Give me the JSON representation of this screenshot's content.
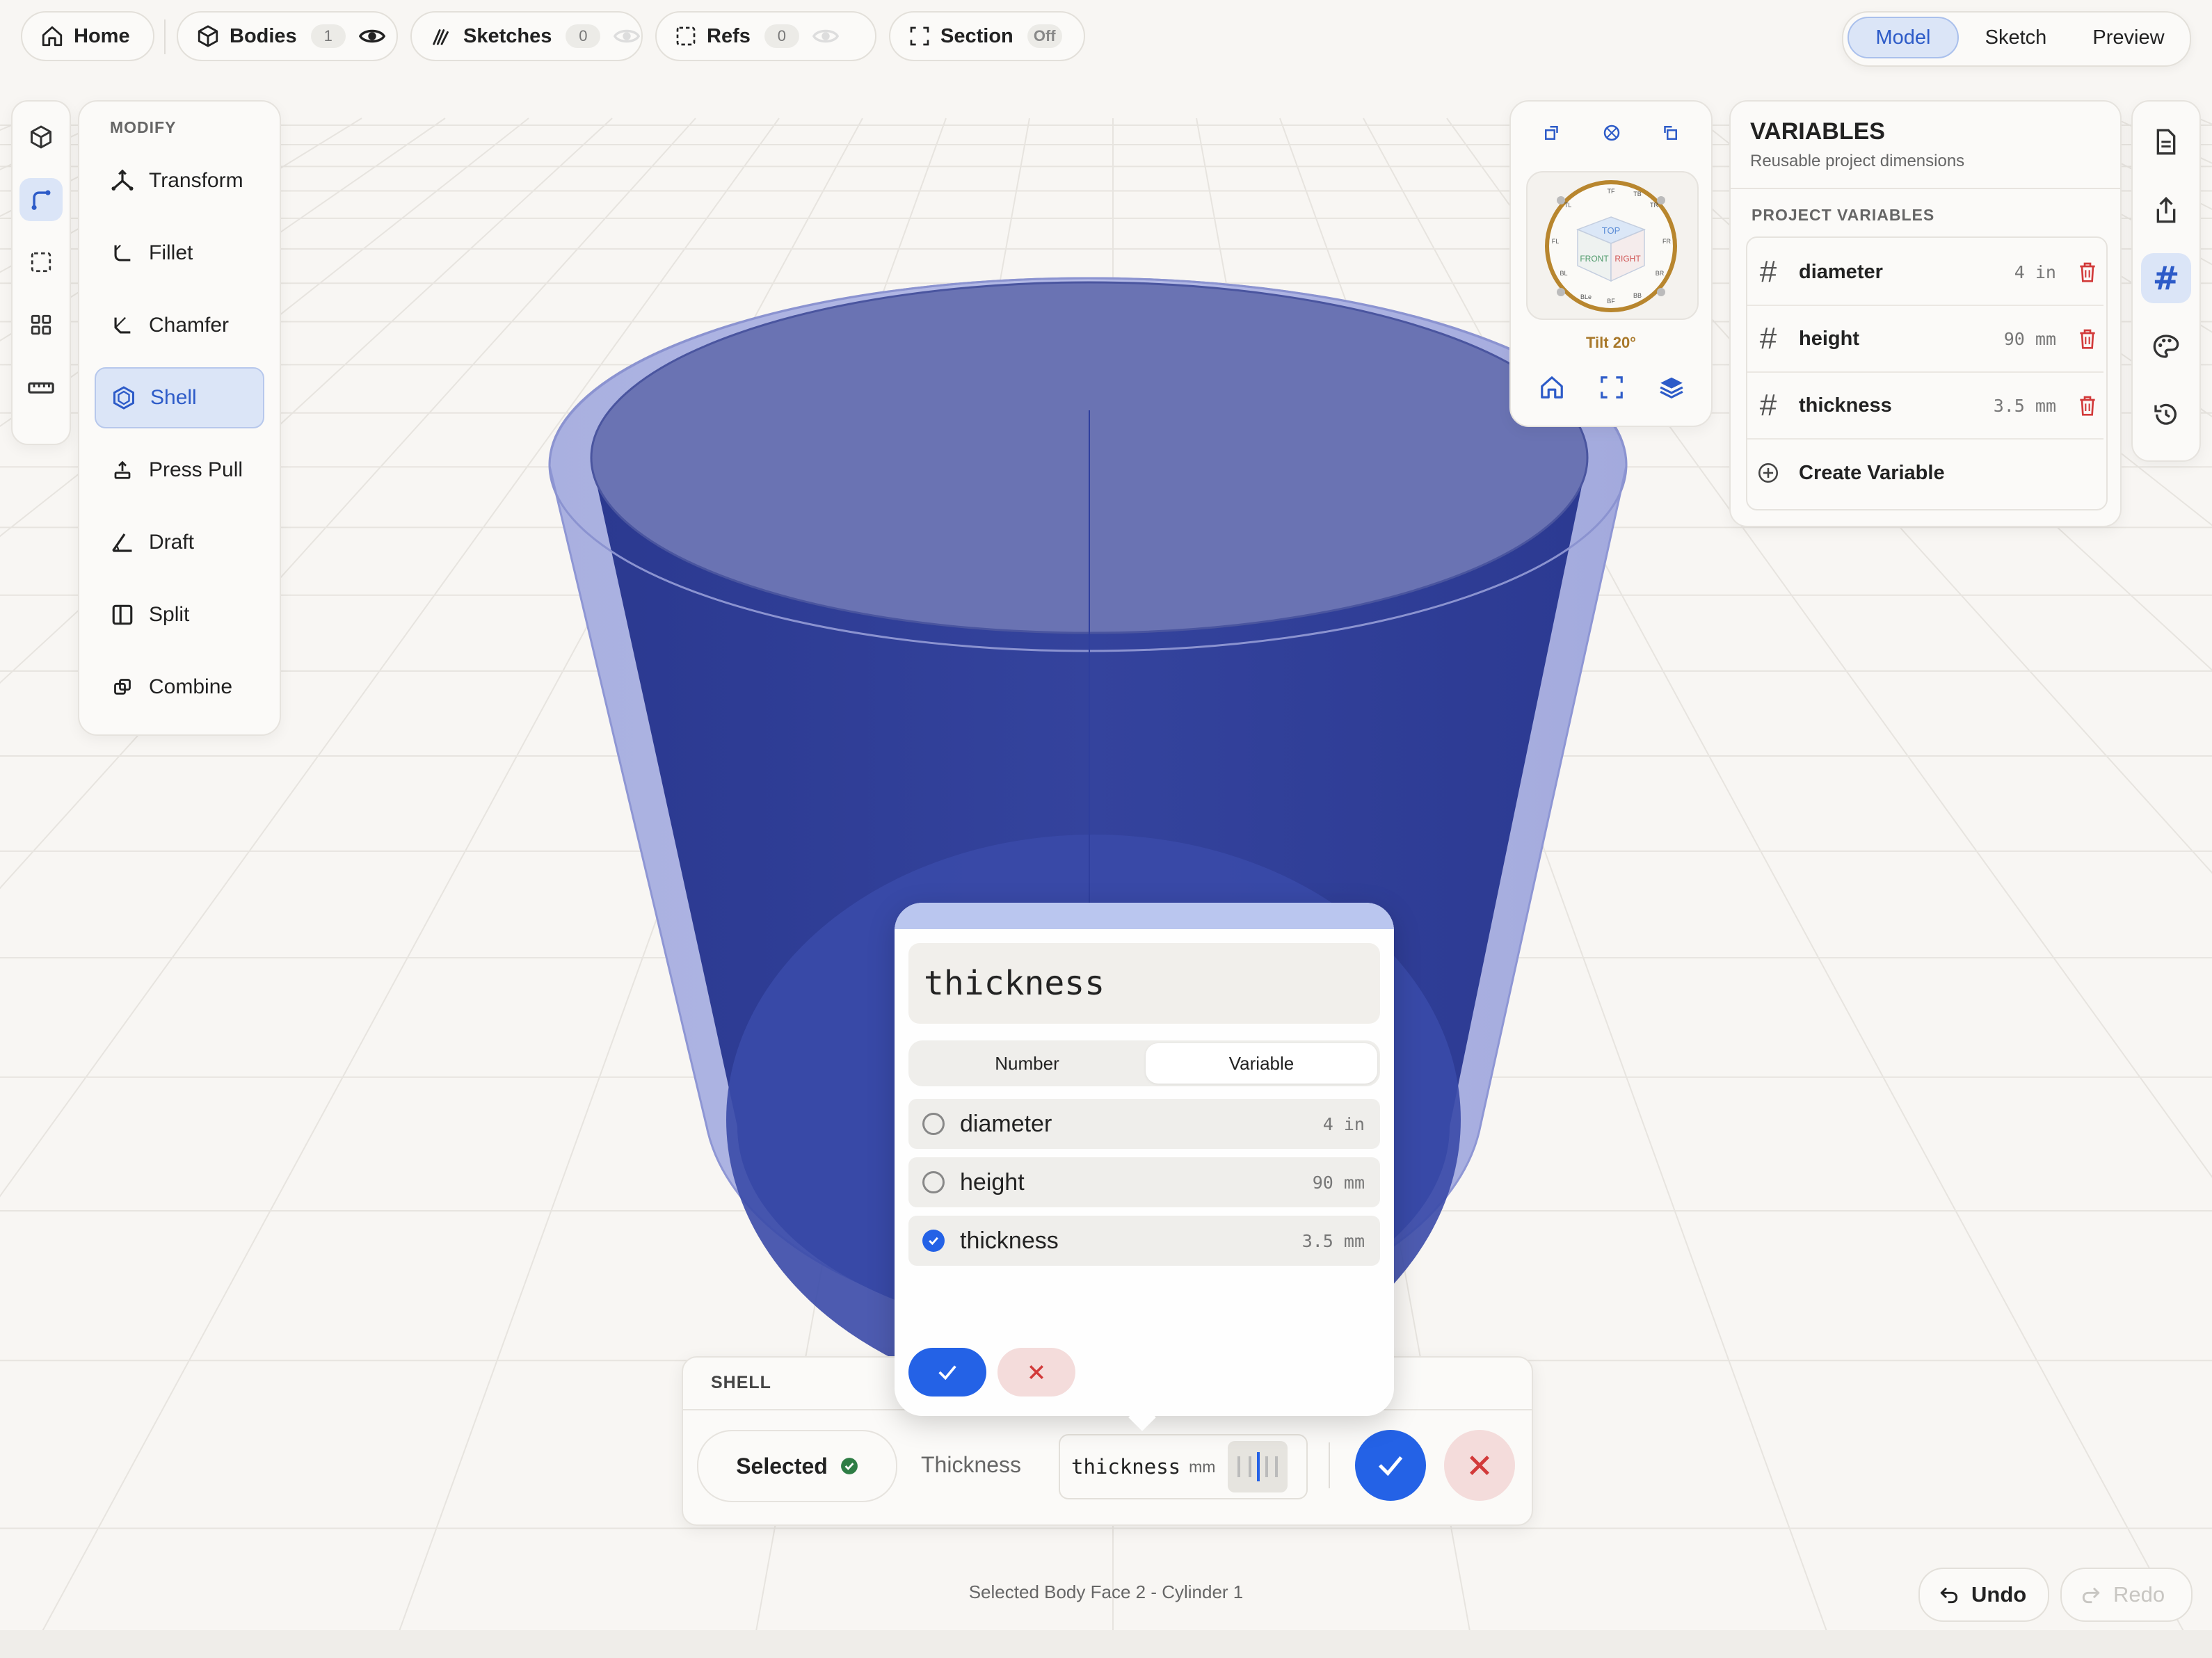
{
  "toolbar": {
    "home_label": "Home",
    "bodies_label": "Bodies",
    "bodies_count": "1",
    "sketches_label": "Sketches",
    "sketches_count": "0",
    "refs_label": "Refs",
    "refs_count": "0",
    "section_label": "Section",
    "section_state": "Off"
  },
  "mode": {
    "options": [
      "Model",
      "Sketch",
      "Preview"
    ],
    "selected": "Model"
  },
  "modify_panel": {
    "title": "MODIFY",
    "items": [
      {
        "label": "Transform",
        "icon": "transform-icon"
      },
      {
        "label": "Fillet",
        "icon": "fillet-icon"
      },
      {
        "label": "Chamfer",
        "icon": "chamfer-icon"
      },
      {
        "label": "Shell",
        "icon": "shell-icon",
        "active": true
      },
      {
        "label": "Press Pull",
        "icon": "press-pull-icon"
      },
      {
        "label": "Draft",
        "icon": "draft-icon"
      },
      {
        "label": "Split",
        "icon": "split-icon"
      },
      {
        "label": "Combine",
        "icon": "combine-icon"
      }
    ]
  },
  "nav_cube": {
    "tilt_label": "Tilt 20°",
    "faces": {
      "top": "TOP",
      "front": "FRONT",
      "right": "RIGHT"
    },
    "corner_labels": [
      "TF",
      "TR",
      "FR",
      "BR",
      "BB",
      "BF",
      "BL",
      "FL",
      "TL",
      "TB",
      "BLe"
    ]
  },
  "variables": {
    "title": "VARIABLES",
    "subtitle": "Reusable project dimensions",
    "section_label": "PROJECT VARIABLES",
    "items": [
      {
        "name": "diameter",
        "value": "4 in"
      },
      {
        "name": "height",
        "value": "90 mm"
      },
      {
        "name": "thickness",
        "value": "3.5 mm"
      }
    ],
    "create_label": "Create Variable"
  },
  "picker": {
    "input_value": "thickness",
    "tabs": [
      "Number",
      "Variable"
    ],
    "selected_tab": "Variable",
    "options": [
      {
        "name": "diameter",
        "value": "4 in",
        "selected": false
      },
      {
        "name": "height",
        "value": "90 mm",
        "selected": false
      },
      {
        "name": "thickness",
        "value": "3.5 mm",
        "selected": true
      }
    ]
  },
  "shell": {
    "title": "SHELL",
    "selected_label": "Selected",
    "thickness_label": "Thickness",
    "thickness_value": "thickness",
    "unit": "mm"
  },
  "status_text": "Selected Body Face 2 - Cylinder 1",
  "history": {
    "undo_label": "Undo",
    "redo_label": "Redo"
  },
  "colors": {
    "accent": "#2462e6",
    "accent_soft": "#dbe5f7",
    "danger": "#d23a3a",
    "danger_soft": "#f4dcdb",
    "body": "#2e3e95",
    "body_shell": "#a6addf",
    "navcube_ring": "#b8862e"
  }
}
